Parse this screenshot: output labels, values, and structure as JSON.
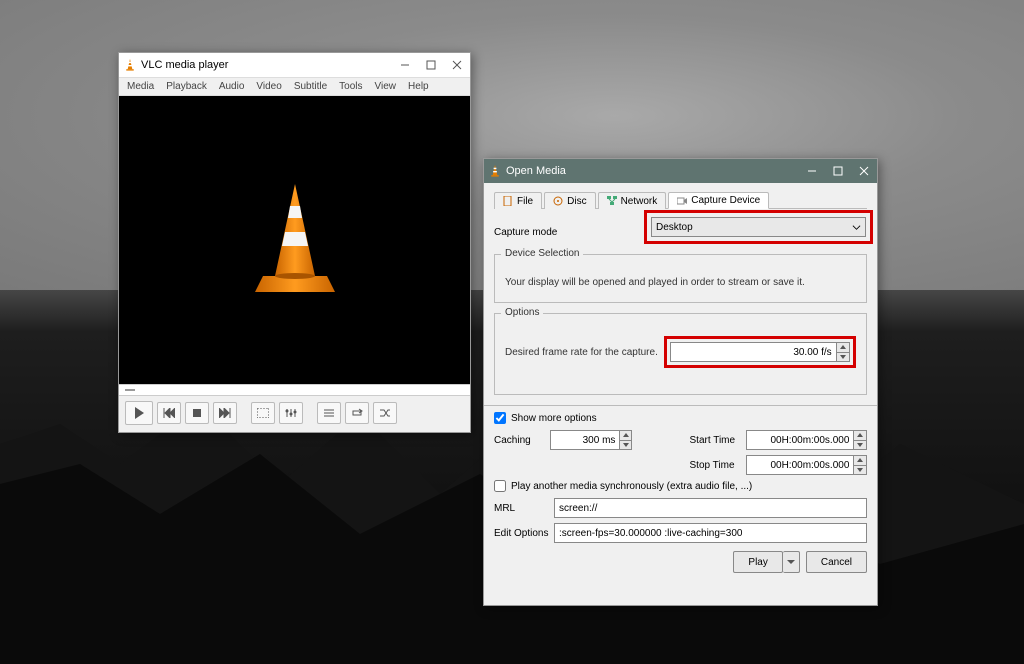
{
  "main_window": {
    "title": "VLC media player",
    "menu": [
      "Media",
      "Playback",
      "Audio",
      "Video",
      "Subtitle",
      "Tools",
      "View",
      "Help"
    ]
  },
  "dialog": {
    "title": "Open Media",
    "tabs": {
      "file": "File",
      "disc": "Disc",
      "network": "Network",
      "capture": "Capture Device"
    },
    "capture_mode_label": "Capture mode",
    "capture_mode_value": "Desktop",
    "device_selection": {
      "legend": "Device Selection",
      "text": "Your display will be opened and played in order to stream or save it."
    },
    "options_group": {
      "legend": "Options",
      "framerate_label": "Desired frame rate for the capture.",
      "framerate_value": "30.00 f/s"
    },
    "show_more": "Show more options",
    "caching_label": "Caching",
    "caching_value": "300 ms",
    "start_time_label": "Start Time",
    "start_time_value": "00H:00m:00s.000",
    "stop_time_label": "Stop Time",
    "stop_time_value": "00H:00m:00s.000",
    "sync_label": "Play another media synchronously (extra audio file, ...)",
    "mrl_label": "MRL",
    "mrl_value": "screen://",
    "edit_options_label": "Edit Options",
    "edit_options_value": ":screen-fps=30.000000 :live-caching=300",
    "play_btn": "Play",
    "cancel_btn": "Cancel"
  },
  "colors": {
    "highlight": "#d40000",
    "dlg_title": "#5f7470"
  }
}
